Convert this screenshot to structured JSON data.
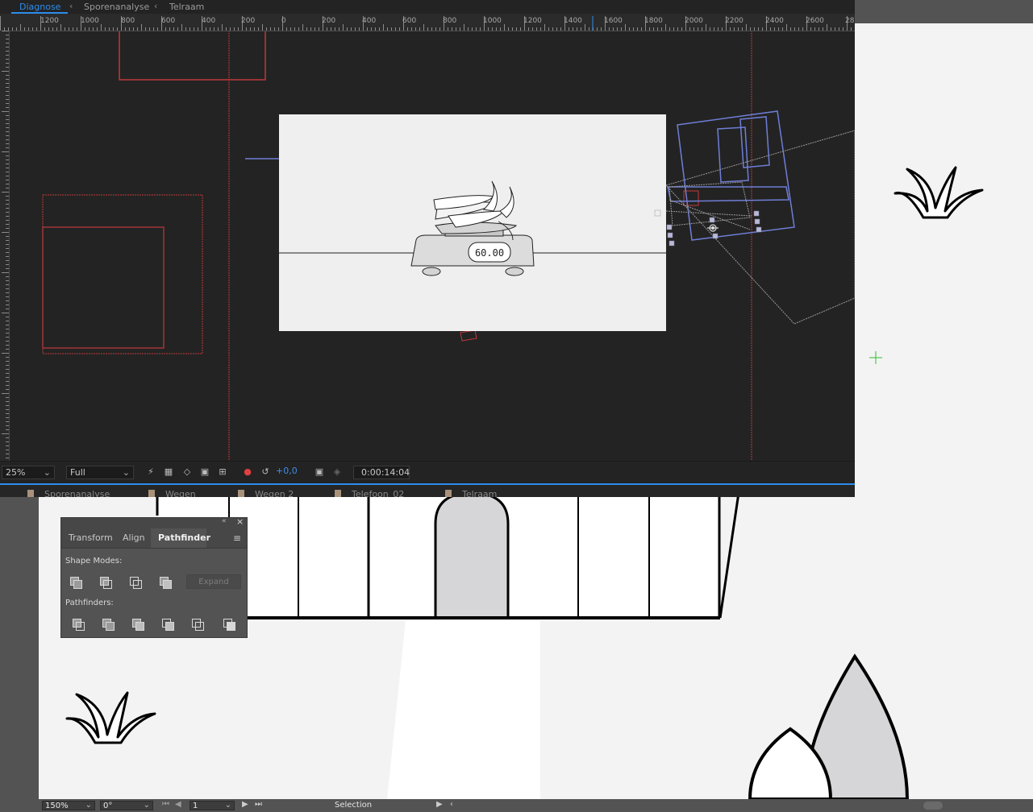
{
  "ae": {
    "tabs": [
      {
        "label": "Diagnose"
      },
      {
        "label": "Sporenanalyse"
      },
      {
        "label": "Telraam"
      }
    ],
    "ruler_top_labels": [
      "1200",
      "1000",
      "800",
      "600",
      "400",
      "200",
      "0",
      "200",
      "400",
      "600",
      "800",
      "1000",
      "1200",
      "1400",
      "1600",
      "1800",
      "2000",
      "2200",
      "2400",
      "2600",
      "28"
    ],
    "viewer": {
      "zoom": "25%",
      "resolution": "Full",
      "exposure": "+0,0",
      "timecode": "0:00:14:04",
      "scale_display": "60.00"
    },
    "timeline_tabs": [
      {
        "label": "Sporenanalyse"
      },
      {
        "label": "Wegen"
      },
      {
        "label": "Wegen 2"
      },
      {
        "label": "Telefoon_02"
      },
      {
        "label": "Telraam"
      }
    ]
  },
  "pathfinder": {
    "tabs": [
      {
        "label": "Transform"
      },
      {
        "label": "Align"
      },
      {
        "label": "Pathfinder"
      }
    ],
    "shape_modes_label": "Shape Modes:",
    "pathfinders_label": "Pathfinders:",
    "expand_label": "Expand"
  },
  "illustrator": {
    "status": {
      "zoom": "150%",
      "rotation": "0°",
      "artboard": "1",
      "tool": "Selection"
    }
  },
  "colors": {
    "accent_blue": "#2d8ceb",
    "guide_red": "#c0393b",
    "path_blue": "#6f7ed6",
    "ae_bg": "#232323"
  }
}
